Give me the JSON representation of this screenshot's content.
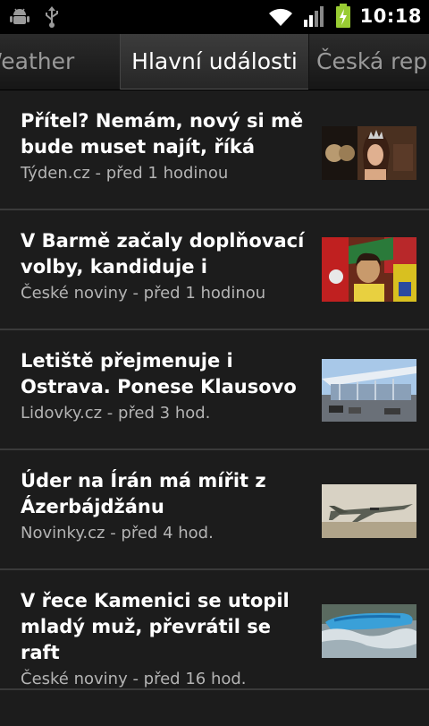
{
  "status_bar": {
    "time": "10:18",
    "icons": [
      "android-debug-icon",
      "usb-icon",
      "wifi-icon",
      "signal-icon",
      "battery-charging-icon"
    ]
  },
  "tabs": {
    "left": "Weather",
    "active": "Hlavní události",
    "right": "Česká republika"
  },
  "news": [
    {
      "title": "Přítel? Nemám, nový si mě bude muset najít, říká",
      "source": "Týden.cz - před 1 hodinou",
      "thumb": "pageant-contestant-photo"
    },
    {
      "title": "V Barmě začaly doplňovací volby, kandiduje i",
      "source": "České noviny - před 1 hodinou",
      "thumb": "barma-election-photo"
    },
    {
      "title": "Letiště přejmenuje i Ostrava. Ponese Klausovo",
      "source": "Lidovky.cz - před 3 hod.",
      "thumb": "airport-terminal-photo"
    },
    {
      "title": "Úder na Írán má mířit z Ázerbájdžánu",
      "source": "Novinky.cz - před 4 hod.",
      "thumb": "fighter-jet-photo"
    },
    {
      "title": "V řece Kamenici se utopil mladý muž, převrátil se raft",
      "source": "České noviny - před 16 hod.",
      "thumb": "river-raft-photo"
    }
  ]
}
